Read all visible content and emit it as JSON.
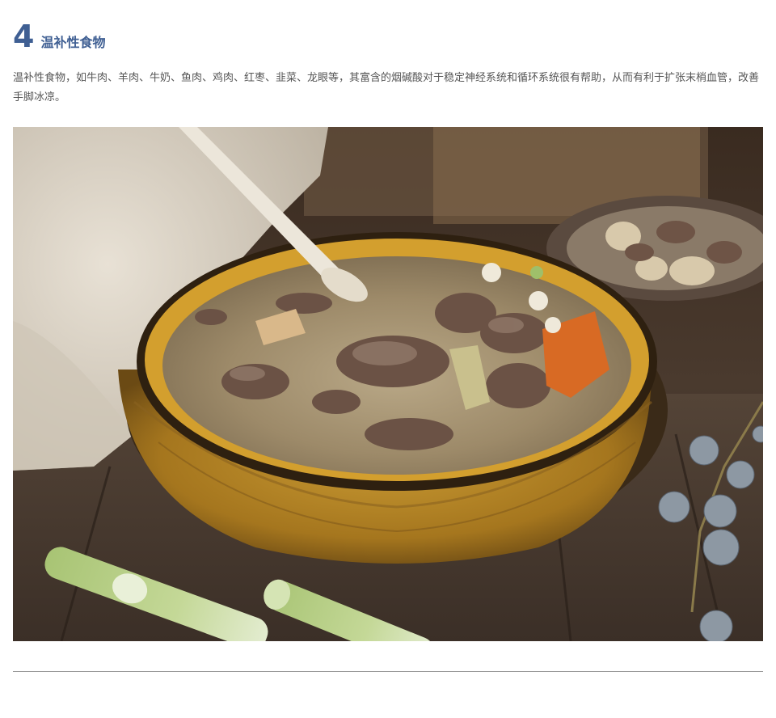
{
  "section": {
    "number": "4",
    "title": "温补性食物"
  },
  "paragraph": "温补性食物，如牛肉、羊肉、牛奶、鱼肉、鸡肉、红枣、韭菜、龙眼等，其富含的烟碱酸对于稳定神经系统和循环系统很有帮助，从而有利于扩张末梢血管，改善手脚冰凉。",
  "colors": {
    "accent": "#3f5f93",
    "body_text": "#555555",
    "divider": "#9a9a9a"
  }
}
